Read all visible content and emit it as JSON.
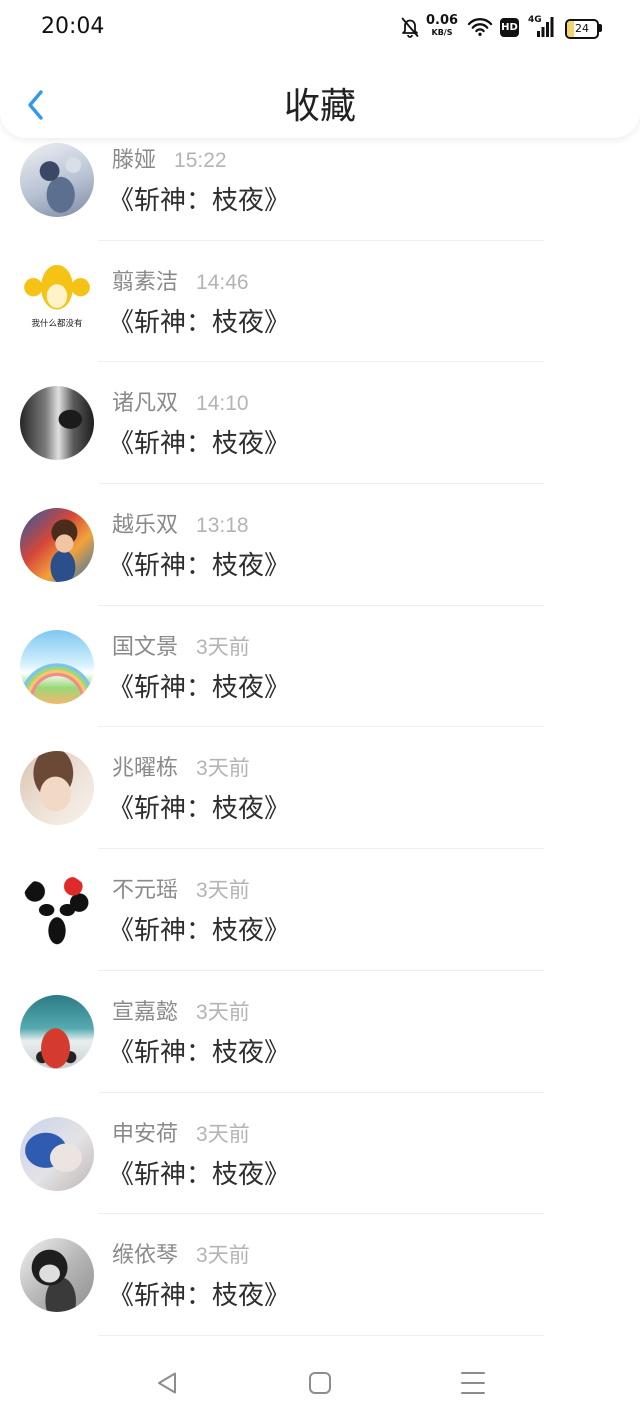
{
  "status_bar": {
    "time": "20:04",
    "net_speed_value": "0.06",
    "net_speed_unit": "KB/S",
    "hd_label": "HD",
    "network_type": "4G",
    "battery_level": "24"
  },
  "header": {
    "title": "收藏"
  },
  "icons": {
    "back": "chevron-left-icon",
    "notifications": "bell-off-icon",
    "wifi": "wifi-icon",
    "signal": "signal-bars-icon",
    "battery": "battery-icon",
    "nav_back": "triangle-back-icon",
    "nav_home": "square-home-icon",
    "nav_menu": "menu-lines-icon"
  },
  "colors": {
    "accent": "#2f9ae8",
    "name_text": "#8a8a8a",
    "time_text": "#b4b4b4",
    "title_text": "#2e2e2e",
    "battery_fill": "#f3d66b"
  },
  "favorites": [
    {
      "name": "滕娅",
      "time": "15:22",
      "title": "《斩神：枝夜》"
    },
    {
      "name": "翦素洁",
      "time": "14:46",
      "title": "《斩神：枝夜》",
      "avatar_caption": "我什么都没有"
    },
    {
      "name": "诸凡双",
      "time": "14:10",
      "title": "《斩神：枝夜》"
    },
    {
      "name": "越乐双",
      "time": "13:18",
      "title": "《斩神：枝夜》"
    },
    {
      "name": "国文景",
      "time": "3天前",
      "title": "《斩神：枝夜》"
    },
    {
      "name": "兆曜栋",
      "time": "3天前",
      "title": "《斩神：枝夜》"
    },
    {
      "name": "不元瑶",
      "time": "3天前",
      "title": "《斩神：枝夜》"
    },
    {
      "name": "宣嘉懿",
      "time": "3天前",
      "title": "《斩神：枝夜》"
    },
    {
      "name": "申安荷",
      "time": "3天前",
      "title": "《斩神：枝夜》"
    },
    {
      "name": "缑依琴",
      "time": "3天前",
      "title": "《斩神：枝夜》"
    }
  ]
}
